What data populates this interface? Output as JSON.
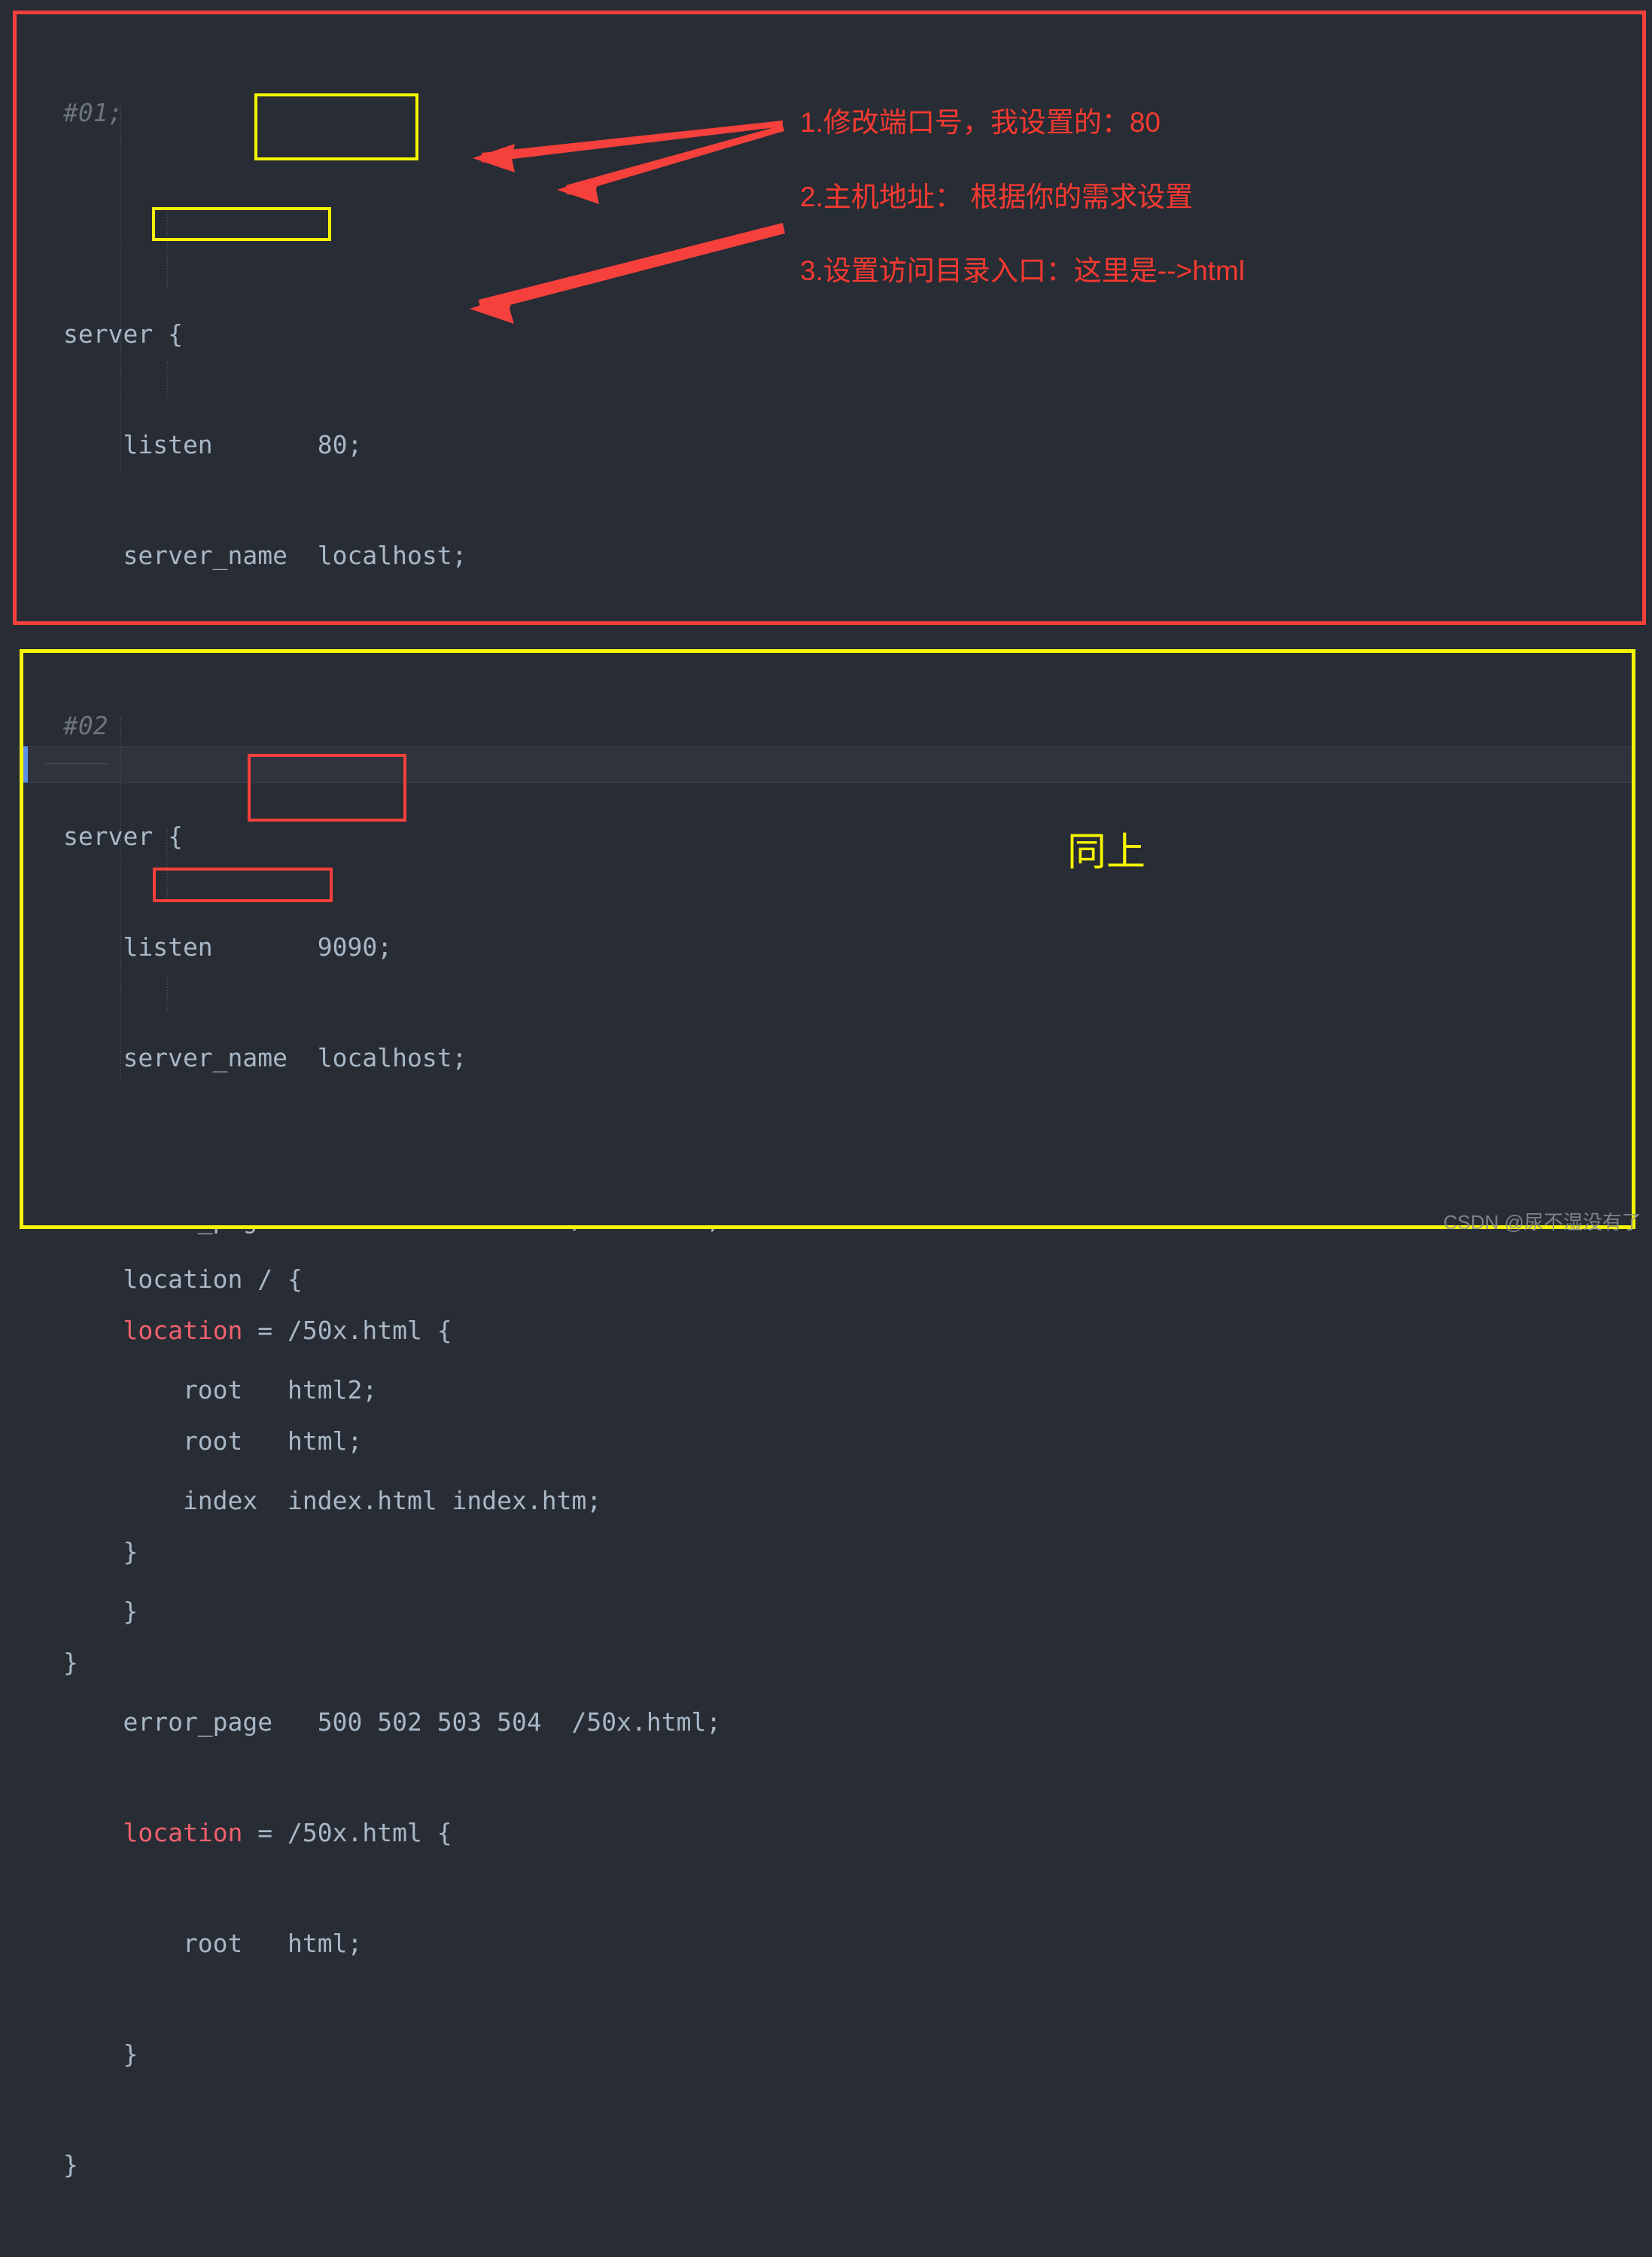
{
  "editor": {
    "theme_background": "#282c34",
    "code_color": "#a9b7c6",
    "comment_color": "#6b737c",
    "keyword_color": "#f0616e"
  },
  "blocks": [
    {
      "id": "01",
      "border_color": "#f6403c",
      "comment": "#01;",
      "lines": [
        "server {",
        "    listen       80;",
        "    server_name  localhost;",
        "",
        "    location / {",
        "        root   html;",
        "        index  index.html index.htm;",
        "    }",
        "    error_page   500 502 503 504  /50x.html;",
        "    location = /50x.html {",
        "        root   html;",
        "    }",
        "}"
      ],
      "highlights": [
        {
          "color": "#f5f500",
          "target": "listen 80; / server_name localhost;"
        },
        {
          "color": "#f5f500",
          "target": "root   html;"
        }
      ]
    },
    {
      "id": "02",
      "border_color": "#f5f500",
      "comment": "#02",
      "lines": [
        "server {",
        "    listen       9090;",
        "    server_name  localhost;",
        "",
        "    location / {",
        "        root   html2;",
        "        index  index.html index.htm;",
        "    }",
        "    error_page   500 502 503 504  /50x.html;",
        "    location = /50x.html {",
        "        root   html;",
        "    }",
        "}"
      ],
      "highlights": [
        {
          "color": "#f6403c",
          "target": "listen 9090; / server_name localhost;"
        },
        {
          "color": "#f6403c",
          "target": "root   html2;"
        }
      ],
      "current_line": "    error_page   500 502 503 504  /50x.html;",
      "caret_color": "#5a8fe6"
    }
  ],
  "annotations": [
    {
      "id": "a1",
      "text": "1.修改端口号，我设置的：80",
      "color": "#f53a31"
    },
    {
      "id": "a2",
      "text": "2.主机地址： 根据你的需求设置",
      "color": "#f53a31"
    },
    {
      "id": "a3",
      "text": "3.设置访问目录入口：这里是-->html",
      "color": "#f53a31"
    },
    {
      "id": "a4",
      "text": "同上",
      "color": "#f5f500"
    }
  ],
  "arrows": {
    "color": "#f5403c",
    "count": 3
  },
  "watermark": {
    "text": "CSDN @尿不湿没有了"
  }
}
